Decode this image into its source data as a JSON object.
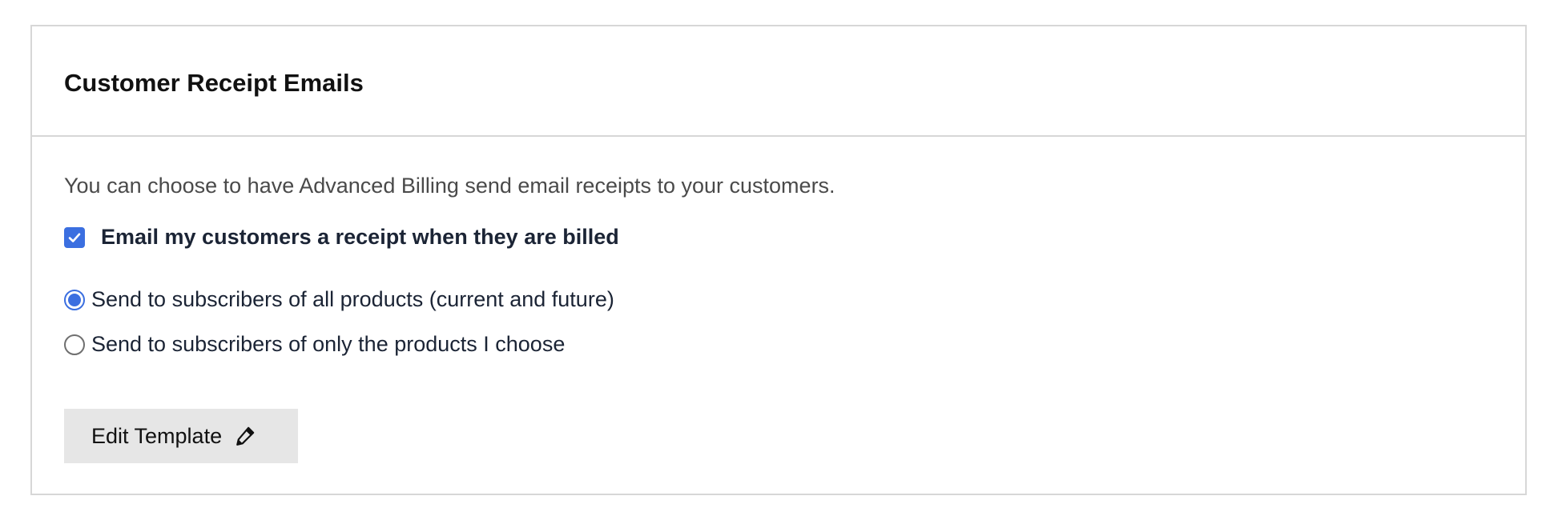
{
  "panel": {
    "title": "Customer Receipt Emails",
    "intro": "You can choose to have Advanced Billing send email receipts to your customers.",
    "checkbox": {
      "label": "Email my customers a receipt when they are billed",
      "checked": true
    },
    "radios": [
      {
        "label": "Send to subscribers of all products (current and future)",
        "checked": true
      },
      {
        "label": "Send to subscribers of only the products I choose",
        "checked": false
      }
    ],
    "edit_button": {
      "label": "Edit Template",
      "icon": "pencil-icon"
    }
  },
  "colors": {
    "accent": "#3b6fe0",
    "border": "#d7d7d7",
    "button_bg": "#e6e6e6"
  }
}
